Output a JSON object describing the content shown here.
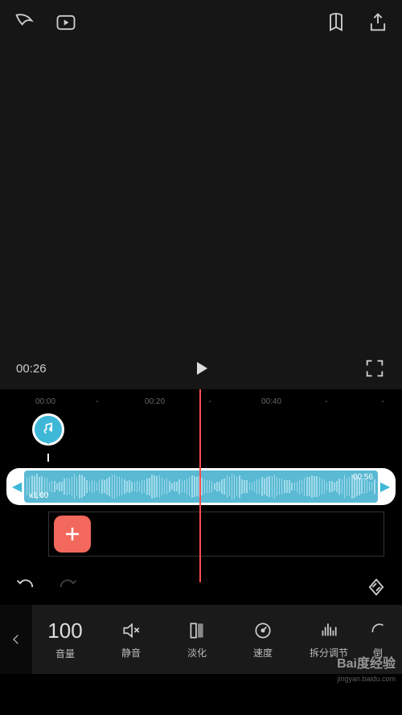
{
  "preview": {
    "current_time": "00:26"
  },
  "ruler": {
    "marks": [
      "00:00",
      "00:20",
      "00:40"
    ]
  },
  "audio_clip": {
    "duration": "00:56",
    "speed": "x1.00"
  },
  "tools": {
    "volume": {
      "value": "100",
      "label": "音量"
    },
    "mute": {
      "label": "静音"
    },
    "fade": {
      "label": "淡化"
    },
    "speed": {
      "label": "速度"
    },
    "fifth": {
      "label": "拆分调节"
    },
    "sixth": {
      "label": "倒"
    }
  },
  "watermark": {
    "brand": "Bai度经验",
    "url": "jingyan.baidu.com"
  }
}
